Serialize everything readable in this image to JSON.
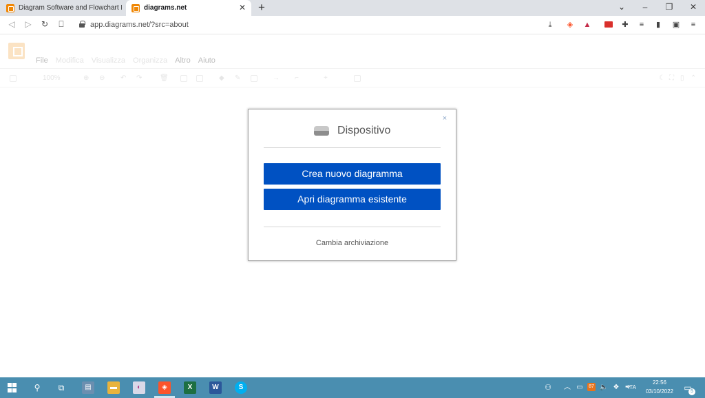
{
  "browser": {
    "tabs": [
      {
        "title": "Diagram Software and Flowchart Maker",
        "active": false
      },
      {
        "title": "diagrams.net",
        "active": true
      }
    ],
    "new_tab": "+",
    "url": "app.diagrams.net/?src=about"
  },
  "app": {
    "menu": [
      {
        "label": "File"
      },
      {
        "label": "Modifica"
      },
      {
        "label": "Visualizza"
      },
      {
        "label": "Organizza"
      },
      {
        "label": "Altro"
      },
      {
        "label": "Aiuto"
      }
    ],
    "zoom": "100%"
  },
  "dialog": {
    "title": "Dispositivo",
    "close": "×",
    "create_button": "Crea nuovo diagramma",
    "open_button": "Apri diagramma esistente",
    "change_storage": "Cambia archiviazione"
  },
  "taskbar": {
    "battery_badge": "87",
    "language": "ITA",
    "time": "22:56",
    "date": "03/10/2022",
    "notifications": "5"
  },
  "colors": {
    "primary_button": "#0051c2",
    "taskbar": "#4a8eb0",
    "drawio_orange": "#f08705"
  }
}
